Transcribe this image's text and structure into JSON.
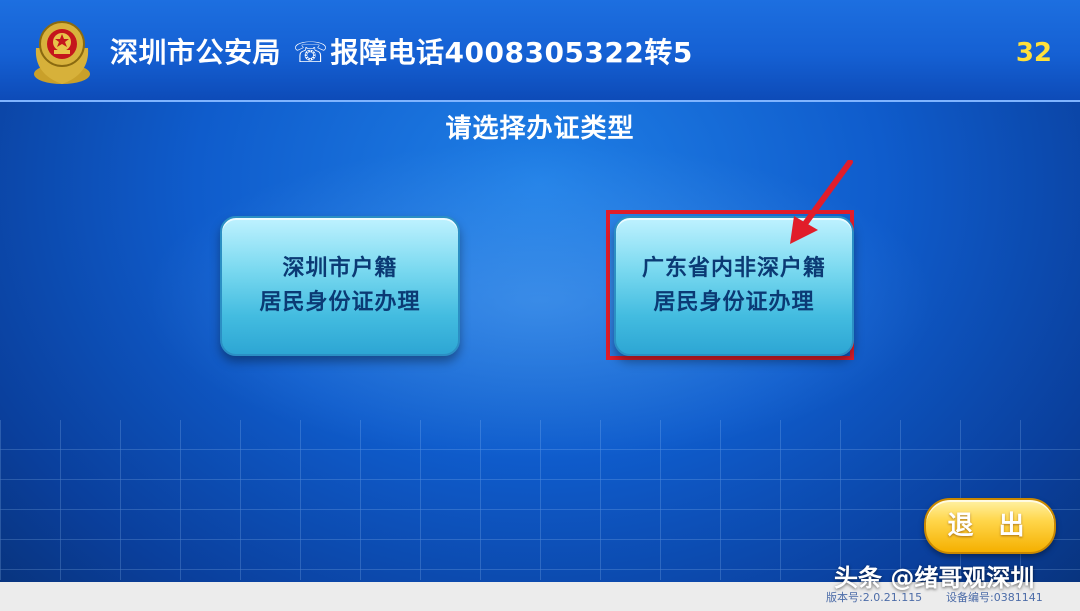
{
  "header": {
    "agency": "深圳市公安局",
    "phone_label": "报障电话4008305322转5",
    "countdown": "32"
  },
  "prompt": "请选择办证类型",
  "options": [
    {
      "line1": "深圳市户籍",
      "line2": "居民身份证办理"
    },
    {
      "line1": "广东省内非深户籍",
      "line2": "居民身份证办理"
    }
  ],
  "exit_label": "退 出",
  "watermark": "头条 @绪哥观深圳",
  "footer": {
    "version": "版本号:2.0.21.115",
    "device": "设备编号:0381141"
  },
  "colors": {
    "highlight": "#e11d2a",
    "countdown": "#ffe03a"
  }
}
